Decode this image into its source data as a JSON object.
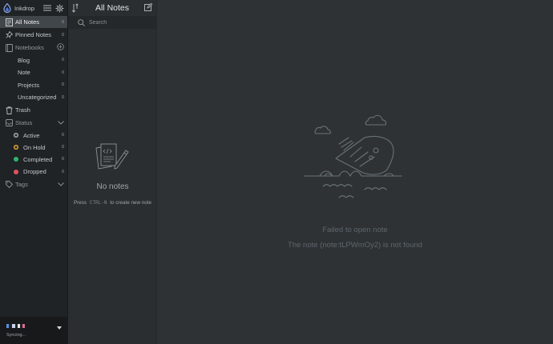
{
  "app": {
    "name": "Inkdrop"
  },
  "sidebar": {
    "all_notes": {
      "label": "All Notes",
      "count": "0"
    },
    "pinned": {
      "label": "Pinned Notes",
      "count": "0"
    },
    "notebooks": {
      "label": "Notebooks",
      "items": [
        {
          "label": "Blog",
          "count": "0"
        },
        {
          "label": "Note",
          "count": "0"
        },
        {
          "label": "Projects",
          "count": "0"
        },
        {
          "label": "Uncategorized",
          "count": "0"
        }
      ]
    },
    "trash": {
      "label": "Trash"
    },
    "status": {
      "label": "Status",
      "items": [
        {
          "label": "Active",
          "count": "0",
          "color": "#a4a9ad"
        },
        {
          "label": "On Hold",
          "count": "0",
          "color": "#e0a030"
        },
        {
          "label": "Completed",
          "count": "0",
          "color": "#2fb36d"
        },
        {
          "label": "Dropped",
          "count": "0",
          "color": "#e05260"
        }
      ]
    },
    "tags": {
      "label": "Tags"
    },
    "sync": {
      "status": "Syncing..."
    }
  },
  "notelist": {
    "title": "All Notes",
    "search_placeholder": "Search",
    "empty_title": "No notes",
    "empty_hint_prefix": "Press",
    "empty_hint_key": "CTRL-N",
    "empty_hint_suffix": "to create new note"
  },
  "main": {
    "error_title": "Failed to open note",
    "error_message": "The note (note:tLPWmOy2) is not found"
  },
  "colors": {
    "sidebar_bg": "#1f2326",
    "notelist_bg": "#2a2e31",
    "main_bg": "#2e3235",
    "active_item_bg": "#41464b",
    "logo_accent": "#4c74d9"
  }
}
